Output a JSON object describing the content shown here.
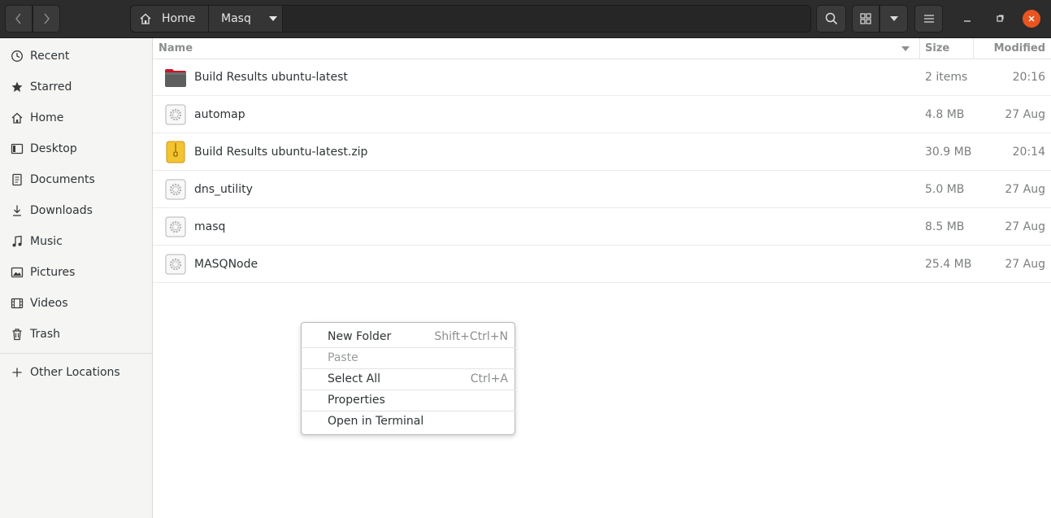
{
  "header": {
    "back_icon": "chevron-left-icon",
    "forward_icon": "chevron-right-icon",
    "path": [
      {
        "label": "Home",
        "icon": "home-icon"
      },
      {
        "label": "Masq",
        "icon": "caret-down-icon"
      }
    ],
    "buttons": [
      "search-icon",
      "grid-view-icon",
      "view-options-caret-icon",
      "hamburger-menu-icon"
    ],
    "window": [
      "minimize-icon",
      "maximize-icon",
      "close-icon"
    ],
    "close_color": "#e95420"
  },
  "sidebar": {
    "items": [
      {
        "label": "Recent",
        "icon": "clock-icon"
      },
      {
        "label": "Starred",
        "icon": "star-icon"
      },
      {
        "label": "Home",
        "icon": "home-icon"
      },
      {
        "label": "Desktop",
        "icon": "desktop-icon"
      },
      {
        "label": "Documents",
        "icon": "document-icon"
      },
      {
        "label": "Downloads",
        "icon": "download-icon"
      },
      {
        "label": "Music",
        "icon": "music-icon"
      },
      {
        "label": "Pictures",
        "icon": "picture-icon"
      },
      {
        "label": "Videos",
        "icon": "video-icon"
      },
      {
        "label": "Trash",
        "icon": "trash-icon"
      }
    ],
    "other": {
      "label": "Other Locations",
      "icon": "plus-icon"
    }
  },
  "columns": {
    "name": "Name",
    "size": "Size",
    "modified": "Modified"
  },
  "files": [
    {
      "name": "Build Results ubuntu-latest",
      "size": "2 items",
      "modified": "20:16",
      "type": "folder"
    },
    {
      "name": "automap",
      "size": "4.8 MB",
      "modified": "27 Aug",
      "type": "executable"
    },
    {
      "name": "Build Results ubuntu-latest.zip",
      "size": "30.9 MB",
      "modified": "20:14",
      "type": "archive"
    },
    {
      "name": "dns_utility",
      "size": "5.0 MB",
      "modified": "27 Aug",
      "type": "executable"
    },
    {
      "name": "masq",
      "size": "8.5 MB",
      "modified": "27 Aug",
      "type": "executable"
    },
    {
      "name": "MASQNode",
      "size": "25.4 MB",
      "modified": "27 Aug",
      "type": "executable"
    }
  ],
  "context_menu": {
    "items": [
      {
        "label": "New Folder",
        "accel": "Shift+Ctrl+N",
        "enabled": true
      },
      {
        "label": "Paste",
        "accel": "",
        "enabled": false
      },
      {
        "label": "Select All",
        "accel": "Ctrl+A",
        "enabled": true
      },
      {
        "label": "Properties",
        "accel": "",
        "enabled": true
      },
      {
        "label": "Open in Terminal",
        "accel": "",
        "enabled": true
      }
    ]
  }
}
